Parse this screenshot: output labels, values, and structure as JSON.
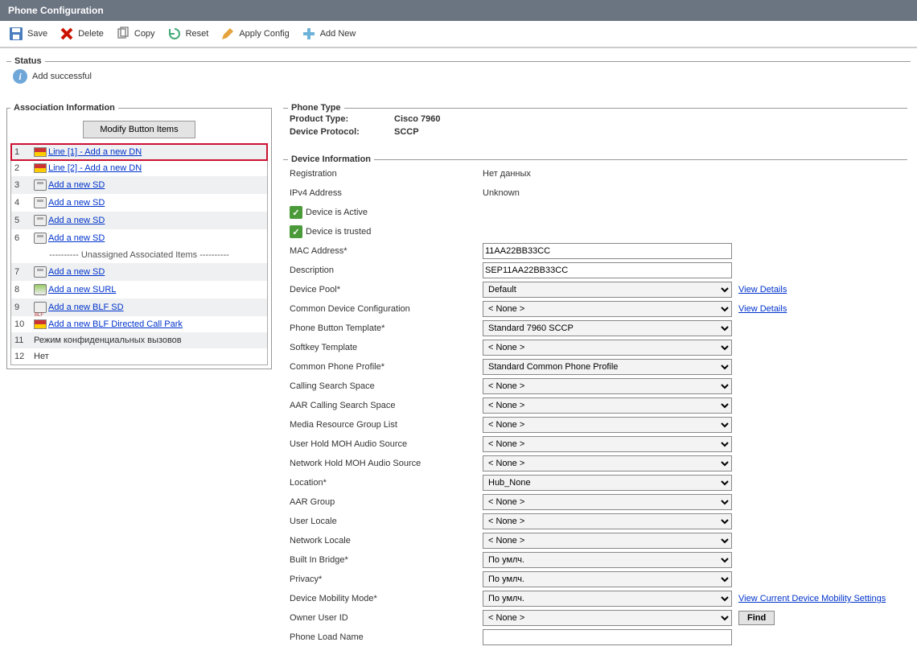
{
  "title": "Phone Configuration",
  "toolbar": {
    "save": "Save",
    "delete": "Delete",
    "copy": "Copy",
    "reset": "Reset",
    "apply": "Apply Config",
    "addnew": "Add New"
  },
  "status": {
    "legend": "Status",
    "msg": "Add successful"
  },
  "assoc": {
    "legend": "Association Information",
    "modify_btn": "Modify Button Items",
    "unassigned_header": "---------- Unassigned Associated Items ----------",
    "items": [
      {
        "idx": "1",
        "link": "Line [1] - Add a new DN",
        "icon": "line",
        "hl": true
      },
      {
        "idx": "2",
        "link": "Line [2] - Add a new DN",
        "icon": "line"
      },
      {
        "idx": "3",
        "link": "Add a new SD",
        "icon": "sd"
      },
      {
        "idx": "4",
        "link": "Add a new SD",
        "icon": "sd"
      },
      {
        "idx": "5",
        "link": "Add a new SD",
        "icon": "sd"
      },
      {
        "idx": "6",
        "link": "Add a new SD",
        "icon": "sd"
      }
    ],
    "unassigned": [
      {
        "idx": "7",
        "link": "Add a new SD",
        "icon": "sd"
      },
      {
        "idx": "8",
        "link": "Add a new SURL",
        "icon": "surl"
      },
      {
        "idx": "9",
        "link": "Add a new BLF SD",
        "icon": "blf"
      },
      {
        "idx": "10",
        "link": "Add a new BLF Directed Call Park",
        "icon": "line"
      },
      {
        "idx": "11",
        "text": "Режим конфиденциальных вызовов"
      },
      {
        "idx": "12",
        "text": "Нет"
      }
    ]
  },
  "phonetype": {
    "legend": "Phone Type",
    "product_label": "Product Type:",
    "product_value": "Cisco 7960",
    "protocol_label": "Device Protocol:",
    "protocol_value": "SCCP"
  },
  "device": {
    "legend": "Device Information",
    "registration_label": "Registration",
    "registration_value": "Нет данных",
    "ipv4_label": "IPv4 Address",
    "ipv4_value": "Unknown",
    "active_label": "Device is Active",
    "trusted_label": "Device is trusted",
    "mac_label": "MAC Address*",
    "mac_value": "11AA22BB33CC",
    "desc_label": "Description",
    "desc_value": "SEP11AA22BB33CC",
    "pool_label": "Device Pool*",
    "pool_value": "Default",
    "view_details": "View Details",
    "cdc_label": "Common Device Configuration",
    "cdc_value": "< None >",
    "pbt_label": "Phone Button Template*",
    "pbt_value": "Standard 7960 SCCP",
    "skt_label": "Softkey Template",
    "skt_value": "< None >",
    "cpp_label": "Common Phone Profile*",
    "cpp_value": "Standard Common Phone Profile",
    "css_label": "Calling Search Space",
    "css_value": "< None >",
    "aarcss_label": "AAR Calling Search Space",
    "aarcss_value": "< None >",
    "mrgl_label": "Media Resource Group List",
    "mrgl_value": "< None >",
    "uhmoh_label": "User Hold MOH Audio Source",
    "uhmoh_value": "< None >",
    "nhmoh_label": "Network Hold MOH Audio Source",
    "nhmoh_value": "< None >",
    "loc_label": "Location*",
    "loc_value": "Hub_None",
    "aargrp_label": "AAR Group",
    "aargrp_value": "< None >",
    "ul_label": "User Locale",
    "ul_value": "< None >",
    "nl_label": "Network Locale",
    "nl_value": "< None >",
    "bib_label": "Built In Bridge*",
    "bib_value": "По умлч.",
    "priv_label": "Privacy*",
    "priv_value": "По умлч.",
    "dmm_label": "Device Mobility Mode*",
    "dmm_value": "По умлч.",
    "dmm_link": "View Current Device Mobility Settings",
    "owner_label": "Owner User ID",
    "owner_value": "< None >",
    "find_btn": "Find",
    "pln_label": "Phone Load Name",
    "pln_value": ""
  }
}
